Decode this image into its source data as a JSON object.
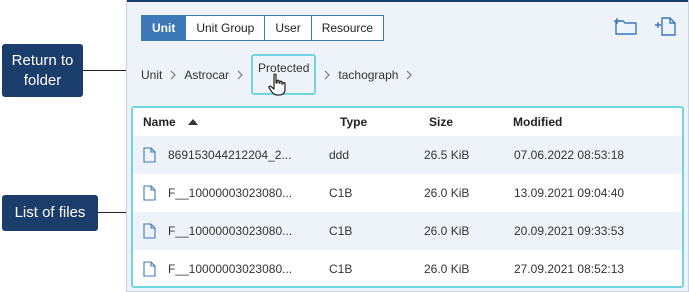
{
  "callouts": {
    "return_to_folder": "Return to folder",
    "list_of_files": "List of files"
  },
  "tabs": [
    {
      "label": "Unit",
      "active": true
    },
    {
      "label": "Unit Group",
      "active": false
    },
    {
      "label": "User",
      "active": false
    },
    {
      "label": "Resource",
      "active": false
    }
  ],
  "toolbar": {
    "icons": [
      "add-folder-icon",
      "add-file-icon"
    ]
  },
  "breadcrumb": [
    "Unit",
    "Astrocar",
    "Protected",
    "tachograph"
  ],
  "table": {
    "columns": {
      "name": "Name",
      "type": "Type",
      "size": "Size",
      "modified": "Modified"
    },
    "rows": [
      {
        "name": "869153044212204_2...",
        "type": "ddd",
        "size": "26.5 KiB",
        "modified": "07.06.2022 08:53:18"
      },
      {
        "name": "F__10000003023080...",
        "type": "C1B",
        "size": "26.0 KiB",
        "modified": "13.09.2021 09:04:40"
      },
      {
        "name": "F__10000003023080...",
        "type": "C1B",
        "size": "26.0 KiB",
        "modified": "20.09.2021 09:33:53"
      },
      {
        "name": "F__10000003023080...",
        "type": "C1B",
        "size": "26.0 KiB",
        "modified": "27.09.2021 08:52:13"
      }
    ]
  },
  "colors": {
    "accent": "#3d78b8",
    "callout": "#1b3d6b",
    "highlight": "#6fd6e0"
  }
}
